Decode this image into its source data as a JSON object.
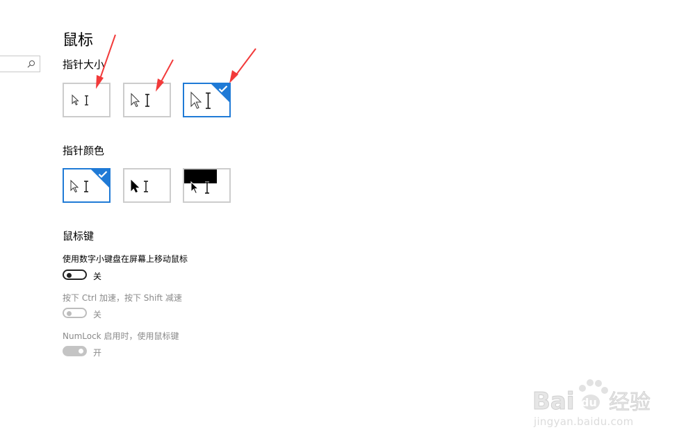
{
  "page": {
    "title": "鼠标"
  },
  "search": {
    "icon": "search-icon"
  },
  "pointer_size": {
    "heading": "指针大小",
    "options": [
      {
        "id": "small",
        "selected": false
      },
      {
        "id": "medium",
        "selected": false
      },
      {
        "id": "large",
        "selected": true
      }
    ]
  },
  "pointer_color": {
    "heading": "指针颜色",
    "options": [
      {
        "id": "white",
        "selected": true
      },
      {
        "id": "black",
        "selected": false
      },
      {
        "id": "inverted",
        "selected": false
      }
    ]
  },
  "mouse_keys": {
    "heading": "鼠标键",
    "settings": [
      {
        "label": "使用数字小键盘在屏幕上移动鼠标",
        "state": "关",
        "on": false,
        "enabled": true
      },
      {
        "label": "按下 Ctrl 加速，按下 Shift 减速",
        "state": "关",
        "on": false,
        "enabled": false
      },
      {
        "label": "NumLock 启用时，使用鼠标键",
        "state": "开",
        "on": true,
        "enabled": false
      }
    ]
  },
  "colors": {
    "accent": "#1f7ad6",
    "annotation_arrow": "#f23a3a"
  },
  "watermark": {
    "brand": "Bai 经验",
    "url": "jingyan.baidu.com"
  }
}
